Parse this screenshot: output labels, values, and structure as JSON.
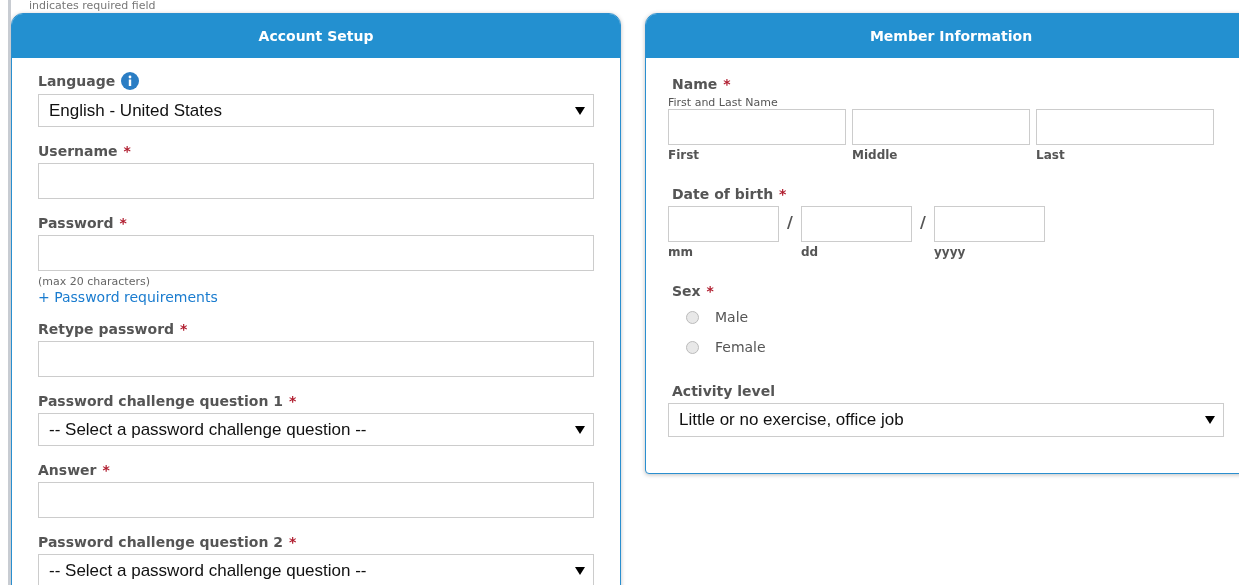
{
  "required_note": "indicates required field",
  "account_setup": {
    "title": "Account Setup",
    "fields": [
      {
        "kind": "select",
        "label": "Language",
        "info_icon": true,
        "value": "English - United States"
      },
      {
        "kind": "text",
        "label": "Username",
        "required_mark": "*",
        "info_icon": false
      },
      {
        "kind": "text",
        "label": "Password",
        "required_mark": "*",
        "info_icon": false,
        "hint": "(max 20 characters)",
        "link": "+ Password requirements"
      },
      {
        "kind": "text",
        "label": "Retype password",
        "required_mark": "*",
        "info_icon": false
      },
      {
        "kind": "select",
        "label": "Password challenge question 1",
        "required_mark": "*",
        "info_icon": false,
        "value": "-- Select a password challenge question --"
      },
      {
        "kind": "text",
        "label": "Answer",
        "required_mark": "*",
        "info_icon": false
      },
      {
        "kind": "select",
        "label": "Password challenge question 2",
        "required_mark": "*",
        "info_icon": false,
        "value": "-- Select a password challenge question --"
      }
    ]
  },
  "member_information": {
    "title": "Member Information",
    "name": {
      "label": "Name",
      "required_mark": "*",
      "hint": "First and Last Name",
      "parts": [
        "First",
        "Middle",
        "Last"
      ]
    },
    "date_of_birth": {
      "label": "Date of birth",
      "required_mark": "*",
      "separator": "/",
      "parts": [
        "mm",
        "dd",
        "yyyy"
      ]
    },
    "sex": {
      "label": "Sex",
      "required_mark": "*",
      "options": [
        {
          "label": "Male",
          "selected": false
        },
        {
          "label": "Female",
          "selected": false
        }
      ]
    },
    "activity_level": {
      "label": "Activity level",
      "value": "Little or no exercise, office job"
    }
  }
}
